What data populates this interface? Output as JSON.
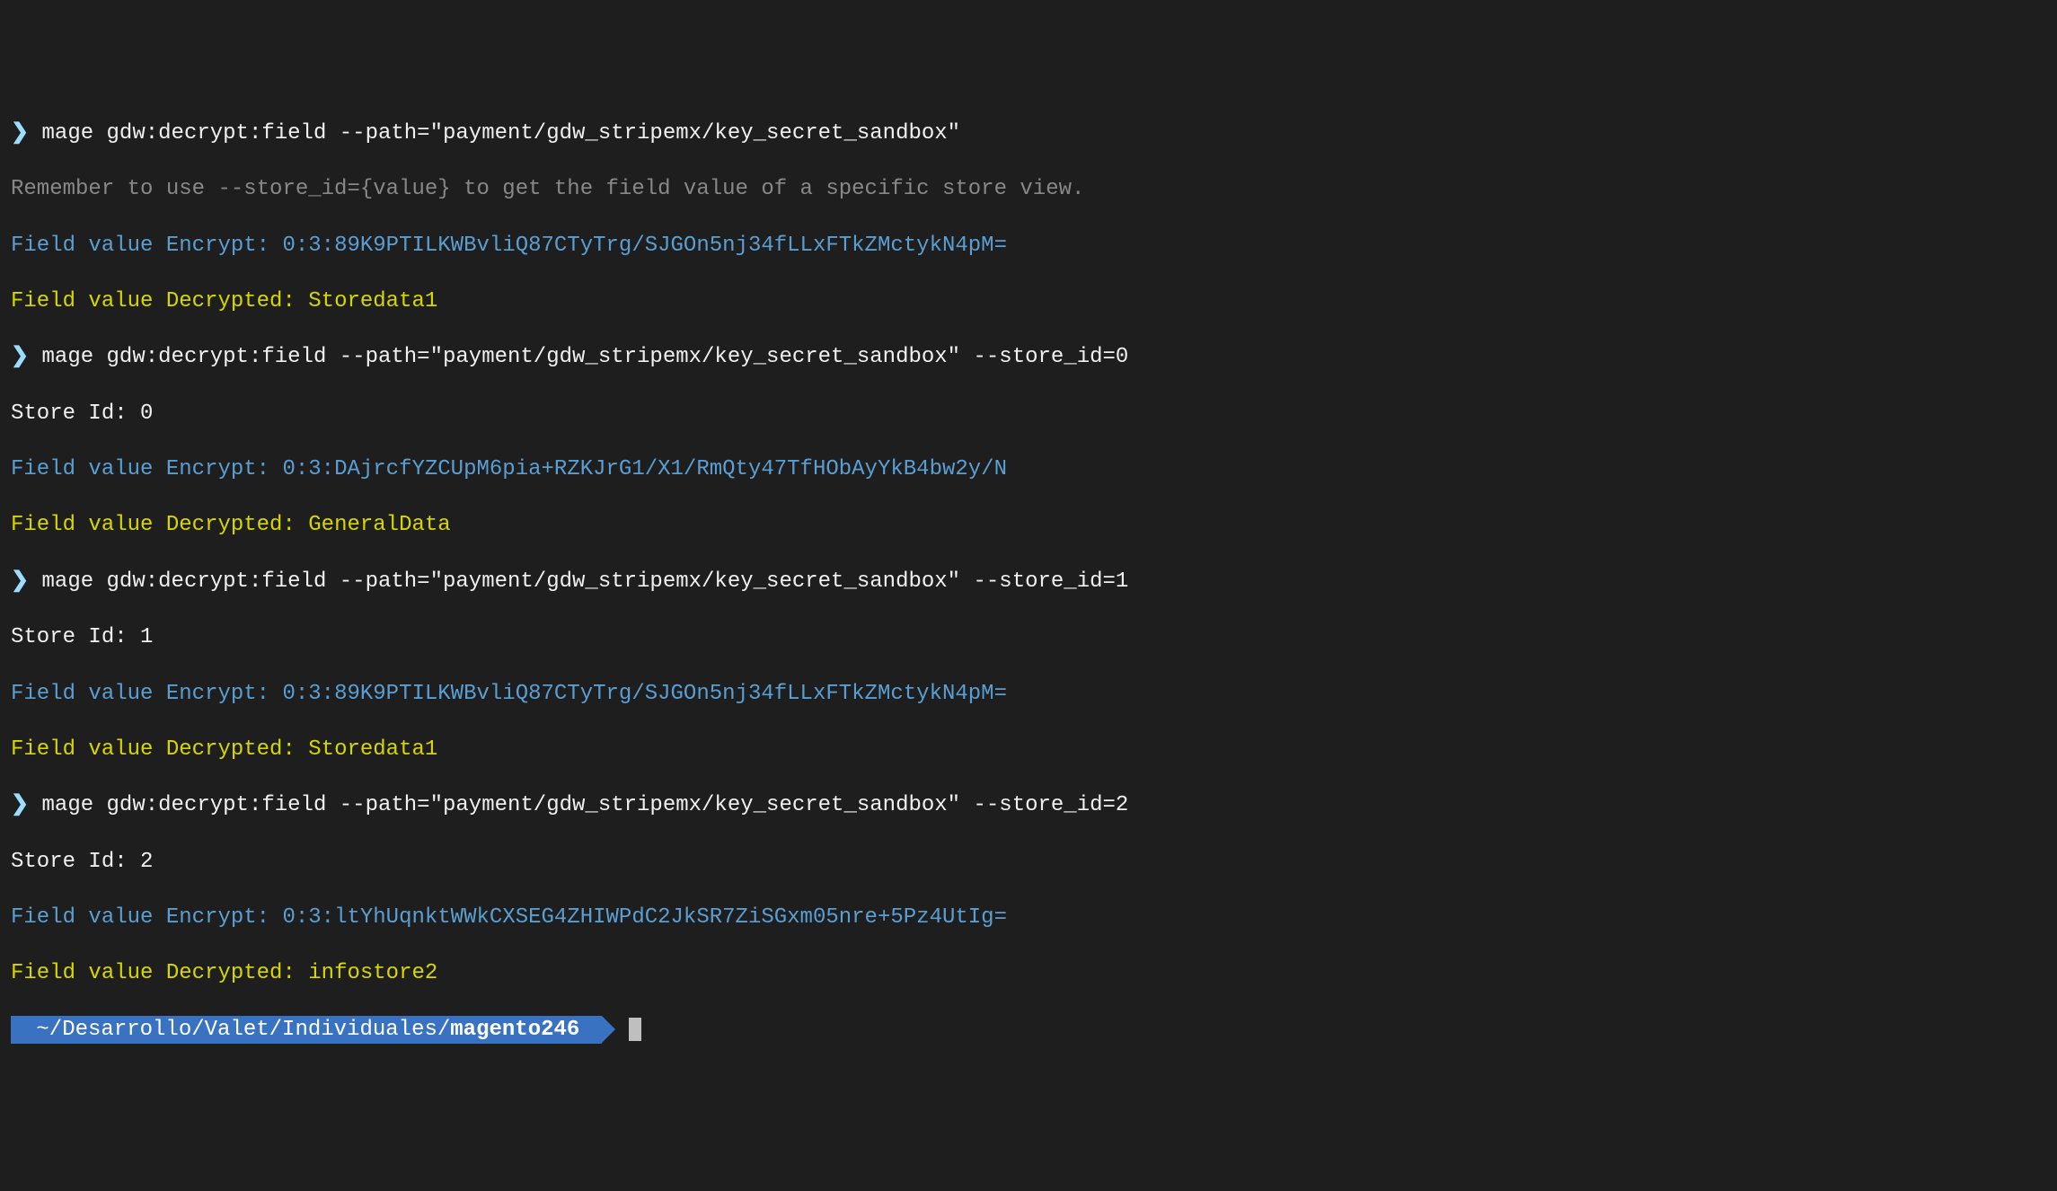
{
  "lines": {
    "l0_prompt": "❯",
    "l0_cmd": " mage gdw:decrypt:field --path=\"payment/gdw_stripemx/key_secret_sandbox\"",
    "l1_hint": "Remember to use --store_id={value} to get the field value of a specific store view.",
    "l2_enc_label": "Field value Encrypt: ",
    "l2_enc_val": "0:3:89K9PTILKWBvliQ87CTyTrg/SJGOn5nj34fLLxFTkZMctykN4pM=",
    "l3_dec_label": "Field value Decrypted: ",
    "l3_dec_val": "Storedata1",
    "l4_prompt": "❯",
    "l4_cmd": " mage gdw:decrypt:field --path=\"payment/gdw_stripemx/key_secret_sandbox\" --store_id=0",
    "l5_store": "Store Id: 0",
    "l6_enc_label": "Field value Encrypt: ",
    "l6_enc_val": "0:3:DAjrcfYZCUpM6pia+RZKJrG1/X1/RmQty47TfHObAyYkB4bw2y/N",
    "l7_dec_label": "Field value Decrypted: ",
    "l7_dec_val": "GeneralData",
    "l8_prompt": "❯",
    "l8_cmd": " mage gdw:decrypt:field --path=\"payment/gdw_stripemx/key_secret_sandbox\" --store_id=1",
    "l9_store": "Store Id: 1",
    "l10_enc_label": "Field value Encrypt: ",
    "l10_enc_val": "0:3:89K9PTILKWBvliQ87CTyTrg/SJGOn5nj34fLLxFTkZMctykN4pM=",
    "l11_dec_label": "Field value Decrypted: ",
    "l11_dec_val": "Storedata1",
    "l12_prompt": "❯",
    "l12_cmd": " mage gdw:decrypt:field --path=\"payment/gdw_stripemx/key_secret_sandbox\" --store_id=2",
    "l13_store": "Store Id: 2",
    "l14_enc_label": "Field value Encrypt: ",
    "l14_enc_val": "0:3:ltYhUqnktWWkCXSEG4ZHIWPdC2JkSR7ZiSGxm05nre+5Pz4UtIg=",
    "l15_dec_label": "Field value Decrypted: ",
    "l15_dec_val": "infostore2",
    "cwd_path": " ~/Desarrollo/Valet/Individuales/",
    "cwd_dir": "magento246 "
  }
}
